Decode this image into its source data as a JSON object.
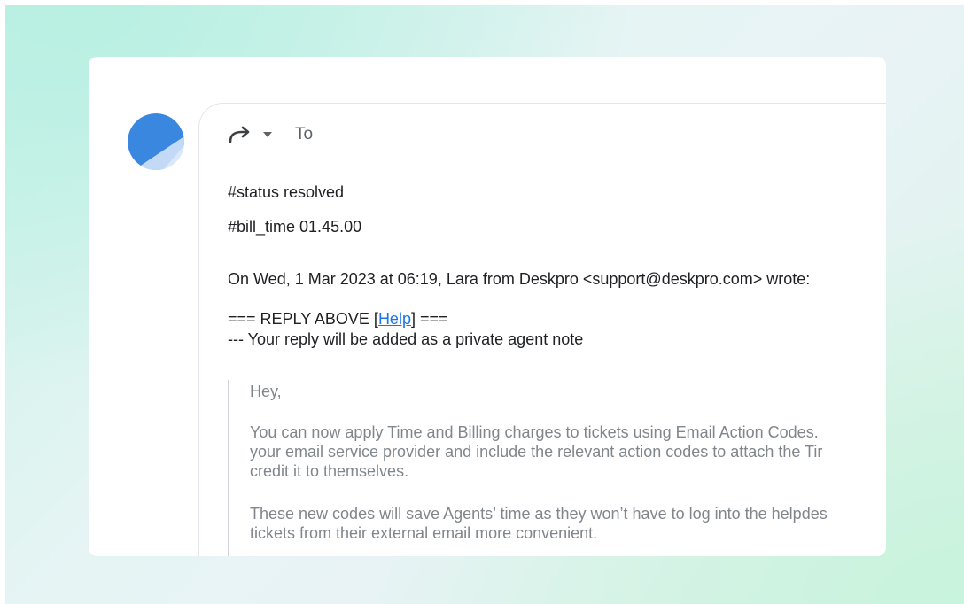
{
  "compose": {
    "to_label": "To",
    "icons": {
      "forward": "forward-arrow-icon",
      "dropdown": "caret-down-icon"
    }
  },
  "avatar": {
    "colors": {
      "primary": "#3a87e0",
      "light": "#b8d3f4",
      "lighter": "#d6e6fa"
    }
  },
  "body": {
    "status_line": "#status resolved",
    "bill_time_line": "#bill_time 01.45.00",
    "attribution": "On Wed, 1 Mar 2023 at 06:19, Lara from Deskpro <support@deskpro.com> wrote:",
    "reply_above_prefix": "=== REPLY ABOVE [",
    "help_link": "Help",
    "reply_above_suffix": "] ===",
    "private_note": "--- Your reply will be added as a private agent note"
  },
  "quote": {
    "greeting": "Hey,",
    "paragraph1": [
      "You can now apply Time and Billing charges to tickets using Email Action Codes.",
      "your email service provider and include the relevant action codes to attach the Tir",
      "credit it to themselves."
    ],
    "paragraph2": [
      "These new codes will save Agents’ time as they won’t have to log into the helpdes",
      "tickets from their external email more convenient."
    ]
  },
  "theme": {
    "link_color": "#1a73e8",
    "quote_text_color": "#80868b",
    "body_text_color": "#202124"
  }
}
